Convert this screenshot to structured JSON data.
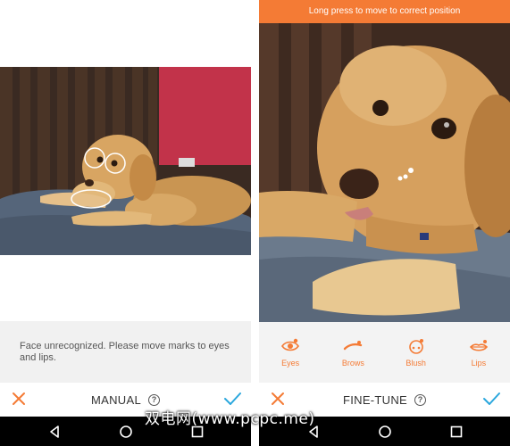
{
  "left": {
    "status_message": "Face unrecognized. Please move marks to eyes and lips.",
    "mode_title": "MANUAL",
    "help_symbol": "?",
    "icons": {
      "cancel": "close-icon",
      "apply": "checkmark-icon",
      "help": "help-circle-icon"
    }
  },
  "right": {
    "hint": "Long press to move to correct position",
    "mode_title": "FINE-TUNE",
    "help_symbol": "?",
    "tools": [
      {
        "label": "Eyes",
        "icon": "eye-icon"
      },
      {
        "label": "Brows",
        "icon": "brow-icon"
      },
      {
        "label": "Blush",
        "icon": "blush-face-icon"
      },
      {
        "label": "Lips",
        "icon": "lips-icon"
      }
    ]
  },
  "android_nav": [
    "back-icon",
    "home-icon",
    "recents-icon"
  ],
  "watermark": "双电网(www.pcpc.me)",
  "colors": {
    "accent": "#f47b35",
    "check": "#2aa7dd",
    "cancel": "#f47b35"
  }
}
